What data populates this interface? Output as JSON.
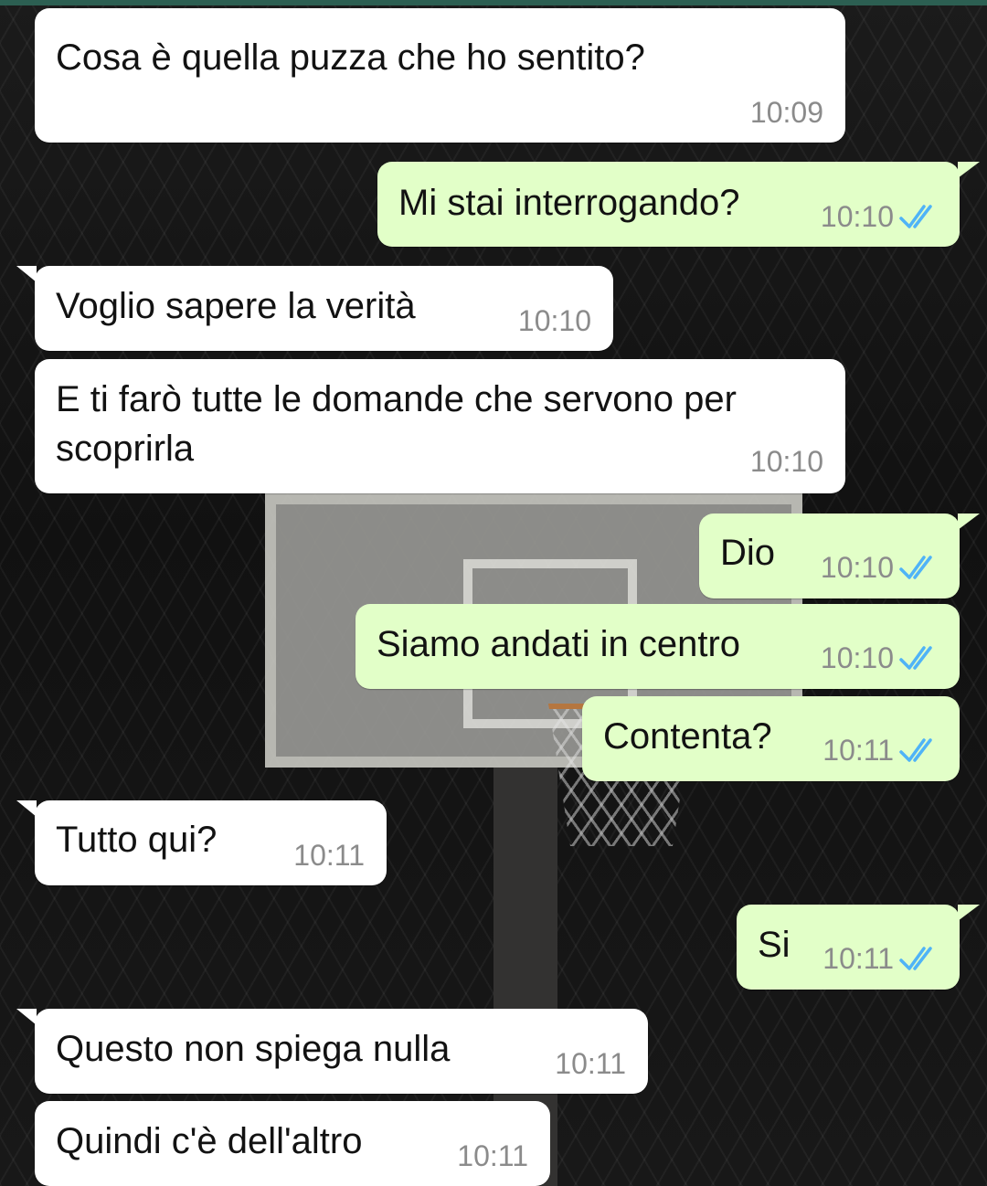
{
  "colors": {
    "incoming_bubble": "#ffffff",
    "outgoing_bubble": "#e2ffc8",
    "timestamp": "#8b8b8b",
    "read_ticks": "#4fb3f7"
  },
  "chat": {
    "messages": [
      {
        "direction": "incoming",
        "text": "Cosa è quella puzza che ho sentito?",
        "time": "10:09"
      },
      {
        "direction": "outgoing",
        "text": "Mi stai interrogando?",
        "time": "10:10",
        "status": "read",
        "status_icon": "double-check-icon"
      },
      {
        "direction": "incoming",
        "text": "Voglio sapere la verità",
        "time": "10:10"
      },
      {
        "direction": "incoming",
        "text": "E ti farò tutte le domande che servono per scoprirla",
        "time": "10:10"
      },
      {
        "direction": "outgoing",
        "text": "Dio",
        "time": "10:10",
        "status": "read",
        "status_icon": "double-check-icon"
      },
      {
        "direction": "outgoing",
        "text": "Siamo andati in centro",
        "time": "10:10",
        "status": "read",
        "status_icon": "double-check-icon"
      },
      {
        "direction": "outgoing",
        "text": "Contenta?",
        "time": "10:11",
        "status": "read",
        "status_icon": "double-check-icon"
      },
      {
        "direction": "incoming",
        "text": "Tutto qui?",
        "time": "10:11"
      },
      {
        "direction": "outgoing",
        "text": "Si",
        "time": "10:11",
        "status": "read",
        "status_icon": "double-check-icon"
      },
      {
        "direction": "incoming",
        "text": "Questo non spiega nulla",
        "time": "10:11"
      },
      {
        "direction": "incoming",
        "text": "Quindi c'è dell'altro",
        "time": "10:11"
      }
    ]
  }
}
